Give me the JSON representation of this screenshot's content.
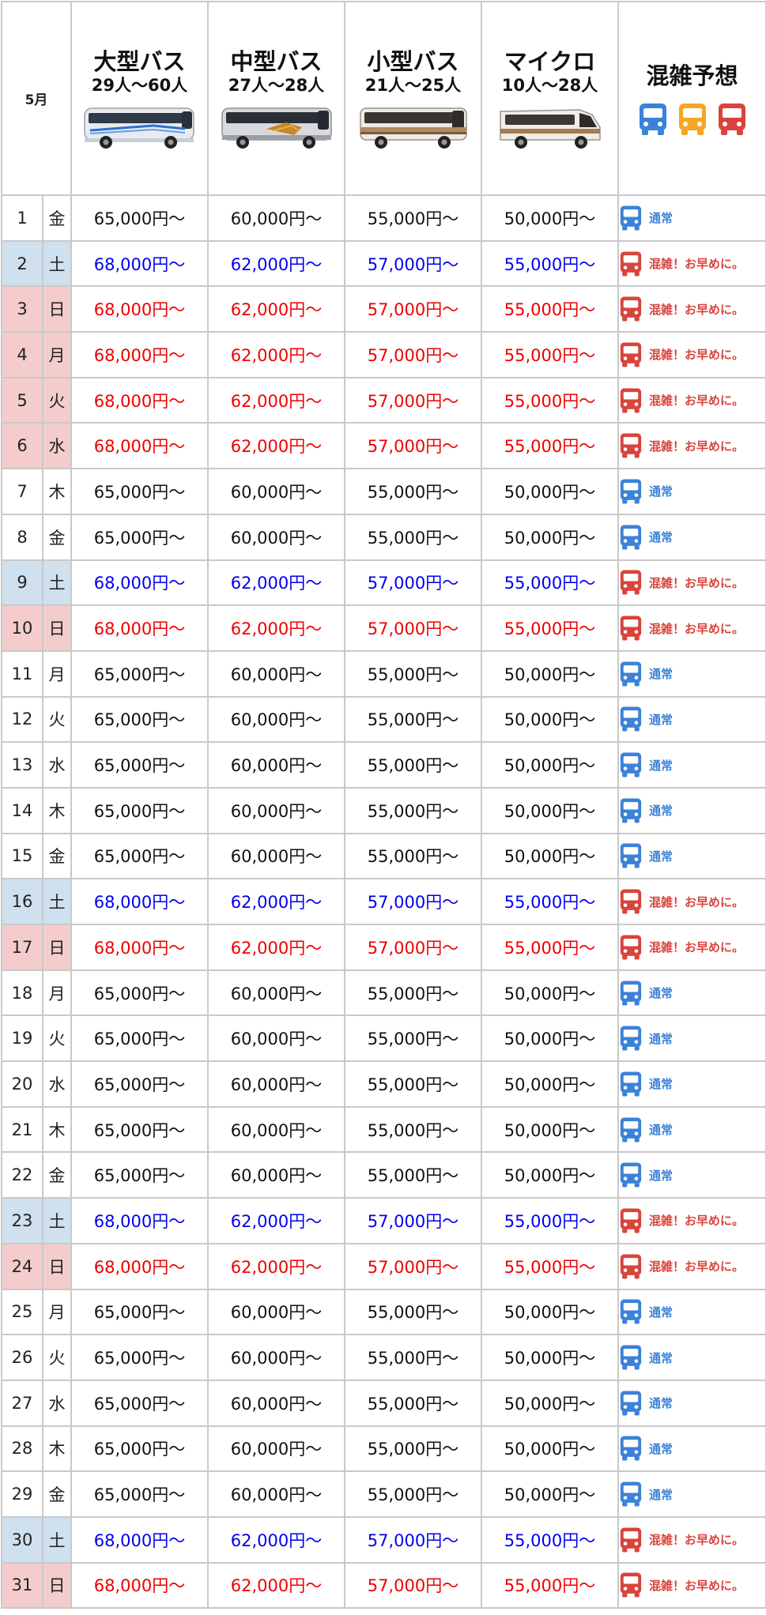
{
  "header": {
    "month": "5月",
    "buses": [
      {
        "name": "大型バス",
        "capacity": "29人〜60人",
        "image": "large-bus-photo"
      },
      {
        "name": "中型バス",
        "capacity": "27人〜28人",
        "image": "medium-bus-photo"
      },
      {
        "name": "小型バス",
        "capacity": "21人〜25人",
        "image": "small-bus-photo"
      },
      {
        "name": "マイクロ",
        "capacity": "10人〜28人",
        "image": "microbus-photo"
      }
    ],
    "congestion_title": "混雑予想",
    "legend_icons": [
      "bus-blue-icon",
      "bus-orange-icon",
      "bus-red-icon"
    ]
  },
  "colors": {
    "normal": "#3b82d8",
    "busy": "#d9443c",
    "caution": "#f5a623",
    "saturday_bg": "#cfe0ef",
    "holiday_bg": "#f4cccc",
    "saturday_text": "#0000ee",
    "holiday_text": "#ee0000"
  },
  "rows": [
    {
      "day": "1",
      "weekday": "金",
      "type": "weekday",
      "prices": [
        "65,000円〜",
        "60,000円〜",
        "55,000円〜",
        "50,000円〜"
      ],
      "congestion": "normal",
      "congestion_label": "通常"
    },
    {
      "day": "2",
      "weekday": "土",
      "type": "sat",
      "prices": [
        "68,000円〜",
        "62,000円〜",
        "57,000円〜",
        "55,000円〜"
      ],
      "congestion": "busy",
      "congestion_label": "混雑！お早めに。"
    },
    {
      "day": "3",
      "weekday": "日",
      "type": "hol",
      "prices": [
        "68,000円〜",
        "62,000円〜",
        "57,000円〜",
        "55,000円〜"
      ],
      "congestion": "busy",
      "congestion_label": "混雑！お早めに。"
    },
    {
      "day": "4",
      "weekday": "月",
      "type": "hol",
      "prices": [
        "68,000円〜",
        "62,000円〜",
        "57,000円〜",
        "55,000円〜"
      ],
      "congestion": "busy",
      "congestion_label": "混雑！お早めに。"
    },
    {
      "day": "5",
      "weekday": "火",
      "type": "hol",
      "prices": [
        "68,000円〜",
        "62,000円〜",
        "57,000円〜",
        "55,000円〜"
      ],
      "congestion": "busy",
      "congestion_label": "混雑！お早めに。"
    },
    {
      "day": "6",
      "weekday": "水",
      "type": "hol",
      "prices": [
        "68,000円〜",
        "62,000円〜",
        "57,000円〜",
        "55,000円〜"
      ],
      "congestion": "busy",
      "congestion_label": "混雑！お早めに。"
    },
    {
      "day": "7",
      "weekday": "木",
      "type": "weekday",
      "prices": [
        "65,000円〜",
        "60,000円〜",
        "55,000円〜",
        "50,000円〜"
      ],
      "congestion": "normal",
      "congestion_label": "通常"
    },
    {
      "day": "8",
      "weekday": "金",
      "type": "weekday",
      "prices": [
        "65,000円〜",
        "60,000円〜",
        "55,000円〜",
        "50,000円〜"
      ],
      "congestion": "normal",
      "congestion_label": "通常"
    },
    {
      "day": "9",
      "weekday": "土",
      "type": "sat",
      "prices": [
        "68,000円〜",
        "62,000円〜",
        "57,000円〜",
        "55,000円〜"
      ],
      "congestion": "busy",
      "congestion_label": "混雑！お早めに。"
    },
    {
      "day": "10",
      "weekday": "日",
      "type": "hol",
      "prices": [
        "68,000円〜",
        "62,000円〜",
        "57,000円〜",
        "55,000円〜"
      ],
      "congestion": "busy",
      "congestion_label": "混雑！お早めに。"
    },
    {
      "day": "11",
      "weekday": "月",
      "type": "weekday",
      "prices": [
        "65,000円〜",
        "60,000円〜",
        "55,000円〜",
        "50,000円〜"
      ],
      "congestion": "normal",
      "congestion_label": "通常"
    },
    {
      "day": "12",
      "weekday": "火",
      "type": "weekday",
      "prices": [
        "65,000円〜",
        "60,000円〜",
        "55,000円〜",
        "50,000円〜"
      ],
      "congestion": "normal",
      "congestion_label": "通常"
    },
    {
      "day": "13",
      "weekday": "水",
      "type": "weekday",
      "prices": [
        "65,000円〜",
        "60,000円〜",
        "55,000円〜",
        "50,000円〜"
      ],
      "congestion": "normal",
      "congestion_label": "通常"
    },
    {
      "day": "14",
      "weekday": "木",
      "type": "weekday",
      "prices": [
        "65,000円〜",
        "60,000円〜",
        "55,000円〜",
        "50,000円〜"
      ],
      "congestion": "normal",
      "congestion_label": "通常"
    },
    {
      "day": "15",
      "weekday": "金",
      "type": "weekday",
      "prices": [
        "65,000円〜",
        "60,000円〜",
        "55,000円〜",
        "50,000円〜"
      ],
      "congestion": "normal",
      "congestion_label": "通常"
    },
    {
      "day": "16",
      "weekday": "土",
      "type": "sat",
      "prices": [
        "68,000円〜",
        "62,000円〜",
        "57,000円〜",
        "55,000円〜"
      ],
      "congestion": "busy",
      "congestion_label": "混雑！お早めに。"
    },
    {
      "day": "17",
      "weekday": "日",
      "type": "hol",
      "prices": [
        "68,000円〜",
        "62,000円〜",
        "57,000円〜",
        "55,000円〜"
      ],
      "congestion": "busy",
      "congestion_label": "混雑！お早めに。"
    },
    {
      "day": "18",
      "weekday": "月",
      "type": "weekday",
      "prices": [
        "65,000円〜",
        "60,000円〜",
        "55,000円〜",
        "50,000円〜"
      ],
      "congestion": "normal",
      "congestion_label": "通常"
    },
    {
      "day": "19",
      "weekday": "火",
      "type": "weekday",
      "prices": [
        "65,000円〜",
        "60,000円〜",
        "55,000円〜",
        "50,000円〜"
      ],
      "congestion": "normal",
      "congestion_label": "通常"
    },
    {
      "day": "20",
      "weekday": "水",
      "type": "weekday",
      "prices": [
        "65,000円〜",
        "60,000円〜",
        "55,000円〜",
        "50,000円〜"
      ],
      "congestion": "normal",
      "congestion_label": "通常"
    },
    {
      "day": "21",
      "weekday": "木",
      "type": "weekday",
      "prices": [
        "65,000円〜",
        "60,000円〜",
        "55,000円〜",
        "50,000円〜"
      ],
      "congestion": "normal",
      "congestion_label": "通常"
    },
    {
      "day": "22",
      "weekday": "金",
      "type": "weekday",
      "prices": [
        "65,000円〜",
        "60,000円〜",
        "55,000円〜",
        "50,000円〜"
      ],
      "congestion": "normal",
      "congestion_label": "通常"
    },
    {
      "day": "23",
      "weekday": "土",
      "type": "sat",
      "prices": [
        "68,000円〜",
        "62,000円〜",
        "57,000円〜",
        "55,000円〜"
      ],
      "congestion": "busy",
      "congestion_label": "混雑！お早めに。"
    },
    {
      "day": "24",
      "weekday": "日",
      "type": "hol",
      "prices": [
        "68,000円〜",
        "62,000円〜",
        "57,000円〜",
        "55,000円〜"
      ],
      "congestion": "busy",
      "congestion_label": "混雑！お早めに。"
    },
    {
      "day": "25",
      "weekday": "月",
      "type": "weekday",
      "prices": [
        "65,000円〜",
        "60,000円〜",
        "55,000円〜",
        "50,000円〜"
      ],
      "congestion": "normal",
      "congestion_label": "通常"
    },
    {
      "day": "26",
      "weekday": "火",
      "type": "weekday",
      "prices": [
        "65,000円〜",
        "60,000円〜",
        "55,000円〜",
        "50,000円〜"
      ],
      "congestion": "normal",
      "congestion_label": "通常"
    },
    {
      "day": "27",
      "weekday": "水",
      "type": "weekday",
      "prices": [
        "65,000円〜",
        "60,000円〜",
        "55,000円〜",
        "50,000円〜"
      ],
      "congestion": "normal",
      "congestion_label": "通常"
    },
    {
      "day": "28",
      "weekday": "木",
      "type": "weekday",
      "prices": [
        "65,000円〜",
        "60,000円〜",
        "55,000円〜",
        "50,000円〜"
      ],
      "congestion": "normal",
      "congestion_label": "通常"
    },
    {
      "day": "29",
      "weekday": "金",
      "type": "weekday",
      "prices": [
        "65,000円〜",
        "60,000円〜",
        "55,000円〜",
        "50,000円〜"
      ],
      "congestion": "normal",
      "congestion_label": "通常"
    },
    {
      "day": "30",
      "weekday": "土",
      "type": "sat",
      "prices": [
        "68,000円〜",
        "62,000円〜",
        "57,000円〜",
        "55,000円〜"
      ],
      "congestion": "busy",
      "congestion_label": "混雑！お早めに。"
    },
    {
      "day": "31",
      "weekday": "日",
      "type": "hol",
      "prices": [
        "68,000円〜",
        "62,000円〜",
        "57,000円〜",
        "55,000円〜"
      ],
      "congestion": "busy",
      "congestion_label": "混雑！お早めに。"
    }
  ]
}
